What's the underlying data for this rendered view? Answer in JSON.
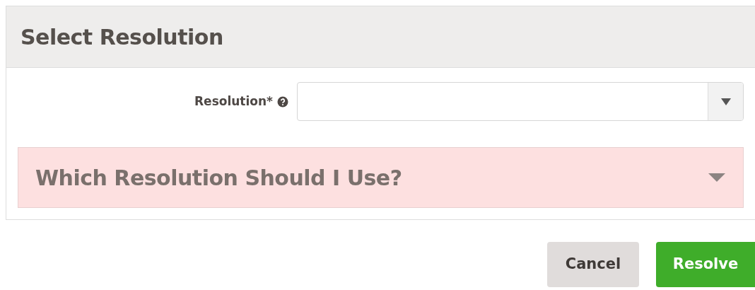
{
  "panel": {
    "title": "Select Resolution"
  },
  "field": {
    "label": "Resolution*"
  },
  "accordion": {
    "title": "Which Resolution Should I Use?",
    "expanded": false
  },
  "buttons": [
    {
      "label": "Cancel",
      "kind": "secondary"
    },
    {
      "label": "Resolve",
      "kind": "primary"
    }
  ]
}
